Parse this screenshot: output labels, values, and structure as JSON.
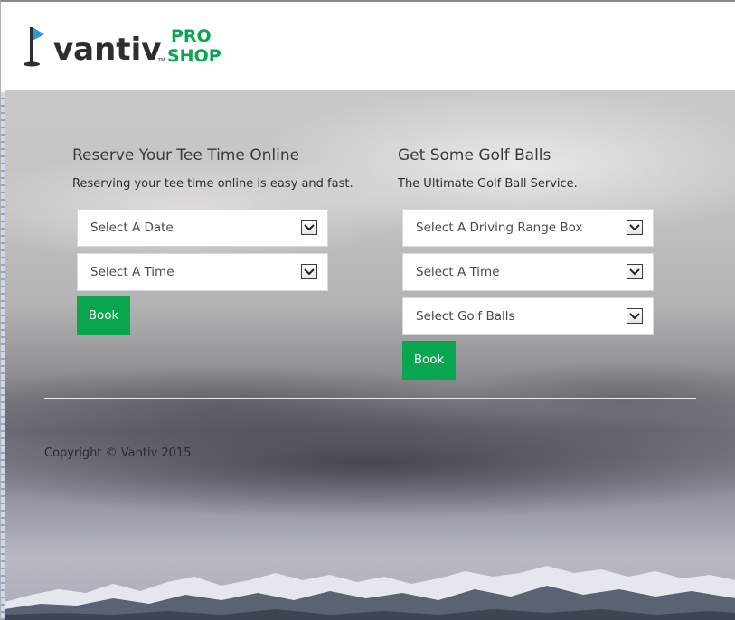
{
  "brand": {
    "name": "vantiv",
    "tm": "TM",
    "pro": "PRO",
    "shop": "SHOP",
    "green": "#0aa64f",
    "flag_blue": "#2a9ad8",
    "text_dark": "#2e2e2e"
  },
  "tee_time": {
    "heading": "Reserve Your Tee Time Online",
    "description": "Reserving your tee time online is easy and fast.",
    "date_select": "Select A Date",
    "time_select": "Select A Time",
    "book_label": "Book"
  },
  "golf_balls": {
    "heading": "Get Some Golf Balls",
    "description": "The Ultimate Golf Ball Service.",
    "range_box_select": "Select A Driving Range Box",
    "time_select": "Select A Time",
    "balls_select": "Select Golf Balls",
    "book_label": "Book"
  },
  "footer": {
    "copyright": "Copyright © Vantiv 2015"
  },
  "icons": {
    "logo_flag": "golf-flag-icon",
    "select_arrow": "chevron-down-icon"
  }
}
